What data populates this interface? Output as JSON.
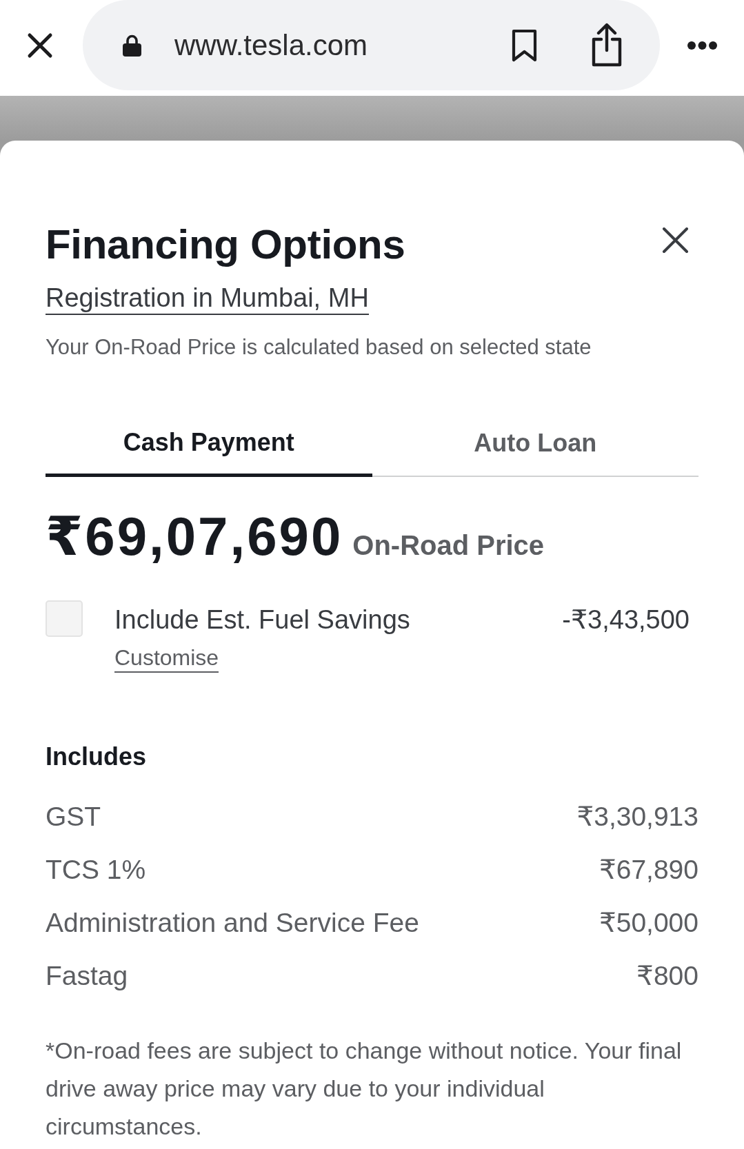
{
  "browser": {
    "url": "www.tesla.com"
  },
  "dialog": {
    "title": "Financing Options",
    "registration_link": "Registration in Mumbai, MH",
    "note": "Your On-Road Price is calculated based on selected state",
    "tabs": [
      {
        "label": "Cash Payment",
        "selected": true
      },
      {
        "label": "Auto Loan",
        "selected": false
      }
    ],
    "price": {
      "amount": "₹69,07,690",
      "caption": "On-Road Price"
    },
    "fuel_savings": {
      "label": "Include Est. Fuel Savings",
      "checked": false,
      "amount": "-₹3,43,500",
      "link": "Customise"
    },
    "includes": {
      "heading": "Includes",
      "items": [
        {
          "label": "GST",
          "amount": "₹3,30,913"
        },
        {
          "label": "TCS 1%",
          "amount": "₹67,890"
        },
        {
          "label": "Administration and Service Fee",
          "amount": "₹50,000"
        },
        {
          "label": "Fastag",
          "amount": "₹800"
        }
      ]
    },
    "footnote": "*On-road fees are subject to change without notice. Your final drive away price may vary due to your individual circumstances."
  }
}
